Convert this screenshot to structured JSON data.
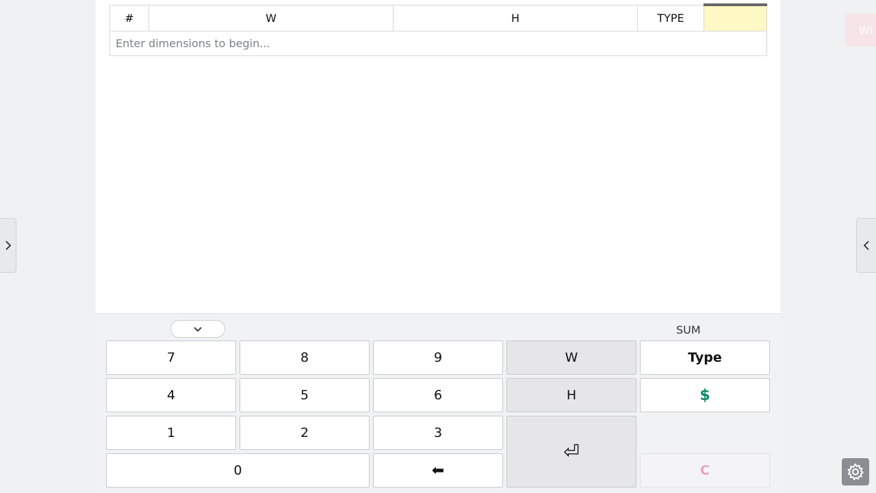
{
  "table": {
    "headers": [
      "#",
      "W",
      "H",
      "TYPE",
      ""
    ],
    "placeholder": "Enter dimensions to begin..."
  },
  "keypad": {
    "sum_label": "SUM",
    "keys": {
      "k7": "7",
      "k8": "8",
      "k9": "9",
      "w": "W",
      "type": "Type",
      "k4": "4",
      "k5": "5",
      "k6": "6",
      "h": "H",
      "dollar": "$",
      "k1": "1",
      "k2": "2",
      "k3": "3",
      "enter": "⏎",
      "k0": "0",
      "backspace": "⬅",
      "clear": "C"
    }
  },
  "ghost_button": {
    "label": "Wi"
  },
  "icons": {
    "collapse": "chevron-down-icon",
    "left_panel": "chevron-right-icon",
    "right_panel": "chevron-left-icon",
    "settings": "gear-icon"
  },
  "colors": {
    "accent_cell": "#fdf8c4",
    "dollar": "#0f8a6a",
    "clear": "#e9a3c7"
  }
}
